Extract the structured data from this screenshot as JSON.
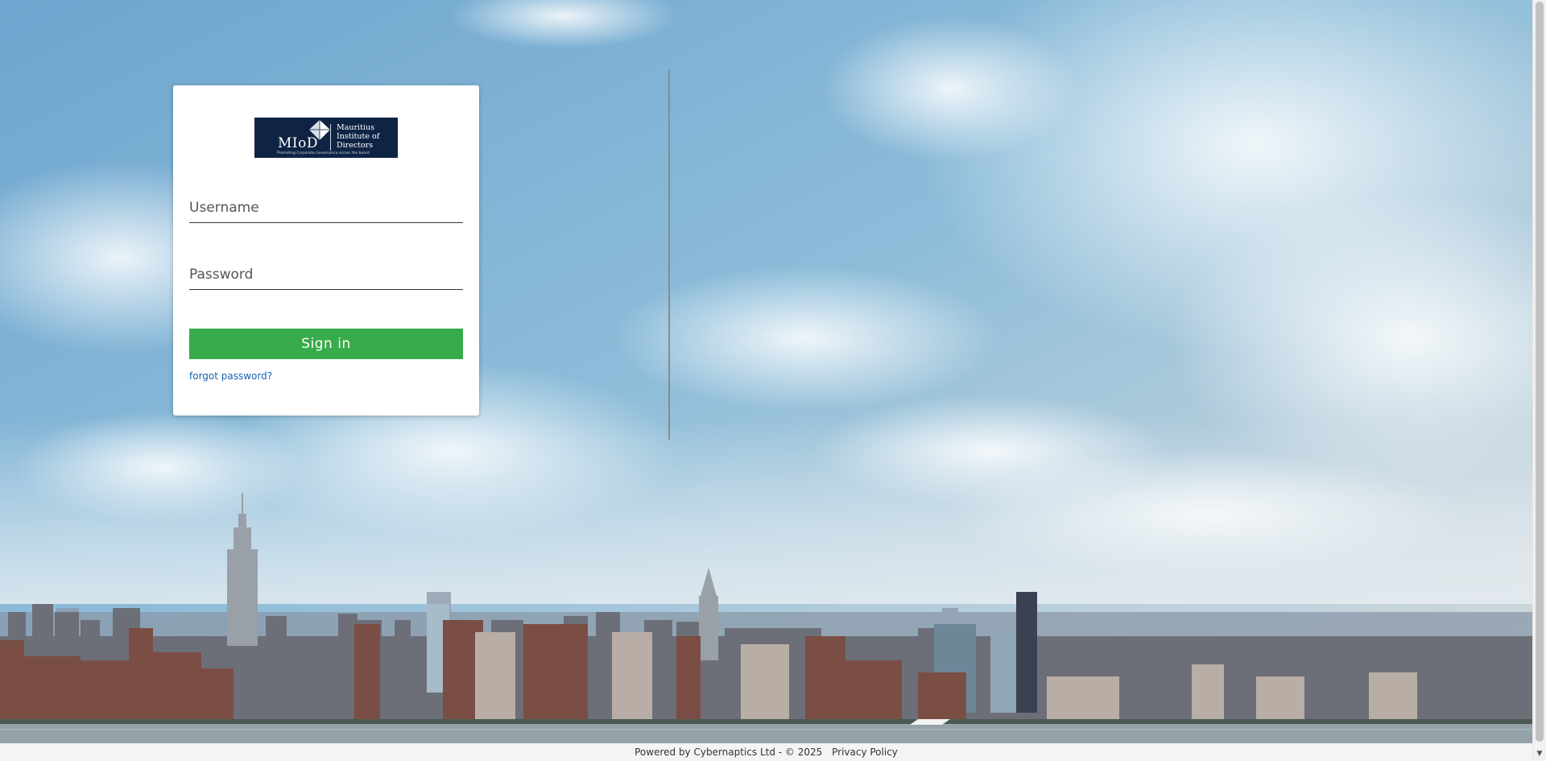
{
  "login": {
    "logo": {
      "abbr": "MIoD",
      "name_line1": "Mauritius",
      "name_line2": "Institute of",
      "name_line3": "Directors",
      "tagline": "Promoting Corporate Governance across the board"
    },
    "username_placeholder": "Username",
    "password_placeholder": "Password",
    "signin_label": "Sign in",
    "forgot_label": "forgot password?"
  },
  "footer": {
    "powered_text": "Powered by Cybernaptics Ltd -  © 2025",
    "privacy_label": "Privacy Policy"
  },
  "colors": {
    "signin_green": "#38ab4a",
    "logo_navy": "#0f2444",
    "link_blue": "#1a5fb4",
    "sky": "#7fb4d6"
  },
  "icons": {
    "logo_mark": "diamond-logo-icon",
    "scroll_up": "chevron-up-icon",
    "scroll_down": "chevron-down-icon"
  }
}
